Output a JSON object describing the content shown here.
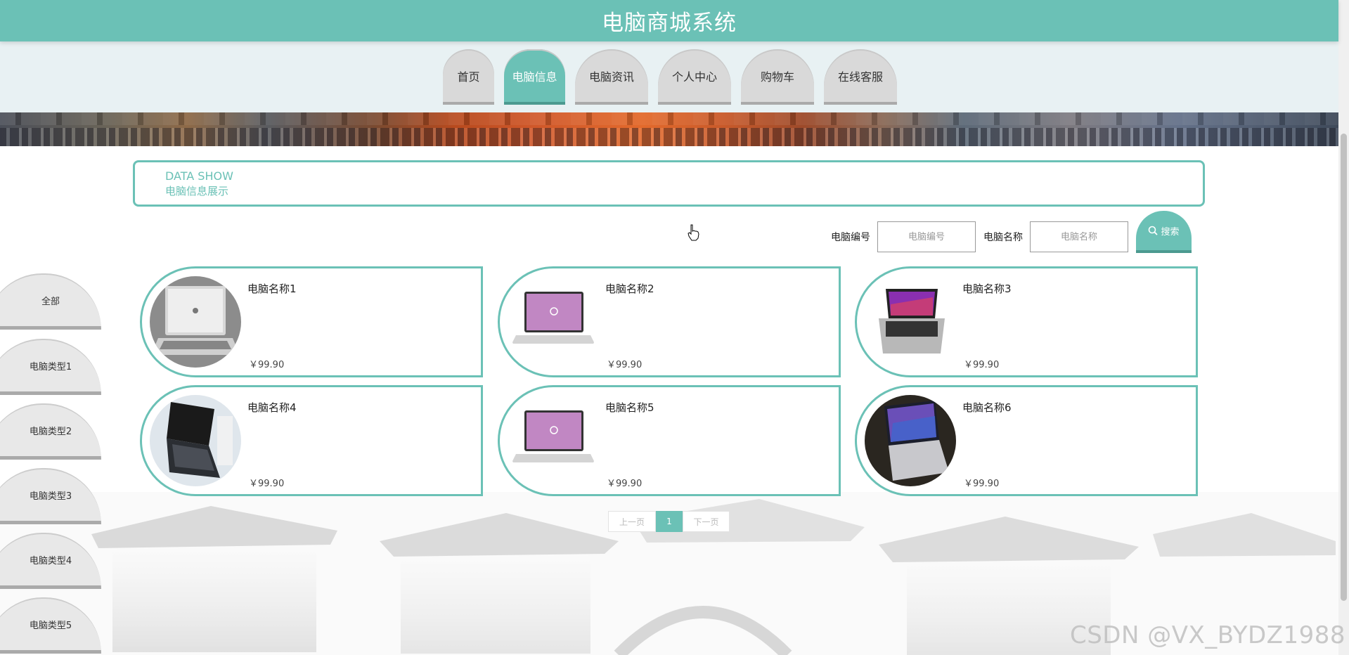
{
  "header": {
    "title": "电脑商城系统"
  },
  "nav": {
    "items": [
      "首页",
      "电脑信息",
      "电脑资讯",
      "个人中心",
      "购物车",
      "在线客服"
    ]
  },
  "datashow": {
    "en": "DATA SHOW",
    "zh": "电脑信息展示"
  },
  "search": {
    "code_label": "电脑编号",
    "code_placeholder": "电脑编号",
    "name_label": "电脑名称",
    "name_placeholder": "电脑名称",
    "button_label": "搜索"
  },
  "categories": [
    "全部",
    "电脑类型1",
    "电脑类型2",
    "电脑类型3",
    "电脑类型4",
    "电脑类型5"
  ],
  "products": [
    {
      "name": "电脑名称1",
      "price": "￥99.90"
    },
    {
      "name": "电脑名称2",
      "price": "￥99.90"
    },
    {
      "name": "电脑名称3",
      "price": "￥99.90"
    },
    {
      "name": "电脑名称4",
      "price": "￥99.90"
    },
    {
      "name": "电脑名称5",
      "price": "￥99.90"
    },
    {
      "name": "电脑名称6",
      "price": "￥99.90"
    }
  ],
  "pager": {
    "prev": "上一页",
    "current": "1",
    "next": "下一页"
  },
  "watermark": "CSDN @VX_BYDZ1988",
  "colors": {
    "accent": "#6bc1b6",
    "accent_dark": "#4c9a90",
    "nav_idle": "#d9d9d9"
  }
}
